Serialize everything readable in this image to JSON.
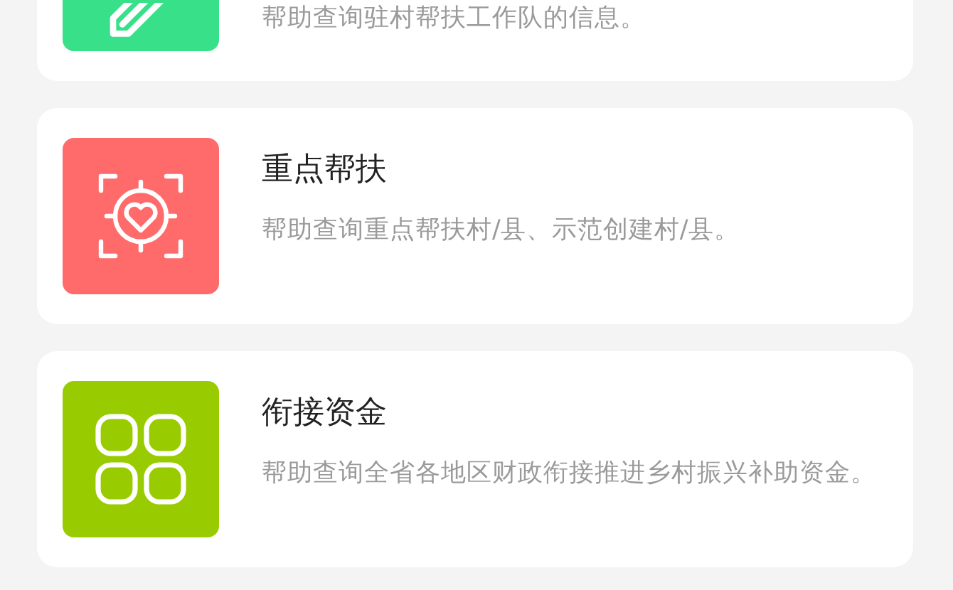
{
  "cards": [
    {
      "kind": "pencil",
      "color": "#38e08a",
      "description": "帮助查询驻村帮扶工作队的信息。"
    },
    {
      "kind": "target",
      "color": "#ff6b6b",
      "title": "重点帮扶",
      "description": "帮助查询重点帮扶村/县、示范创建村/县。"
    },
    {
      "kind": "grid",
      "color": "#99cc00",
      "title": "衔接资金",
      "description": "帮助查询全省各地区财政衔接推进乡村振兴补助资金。"
    }
  ]
}
